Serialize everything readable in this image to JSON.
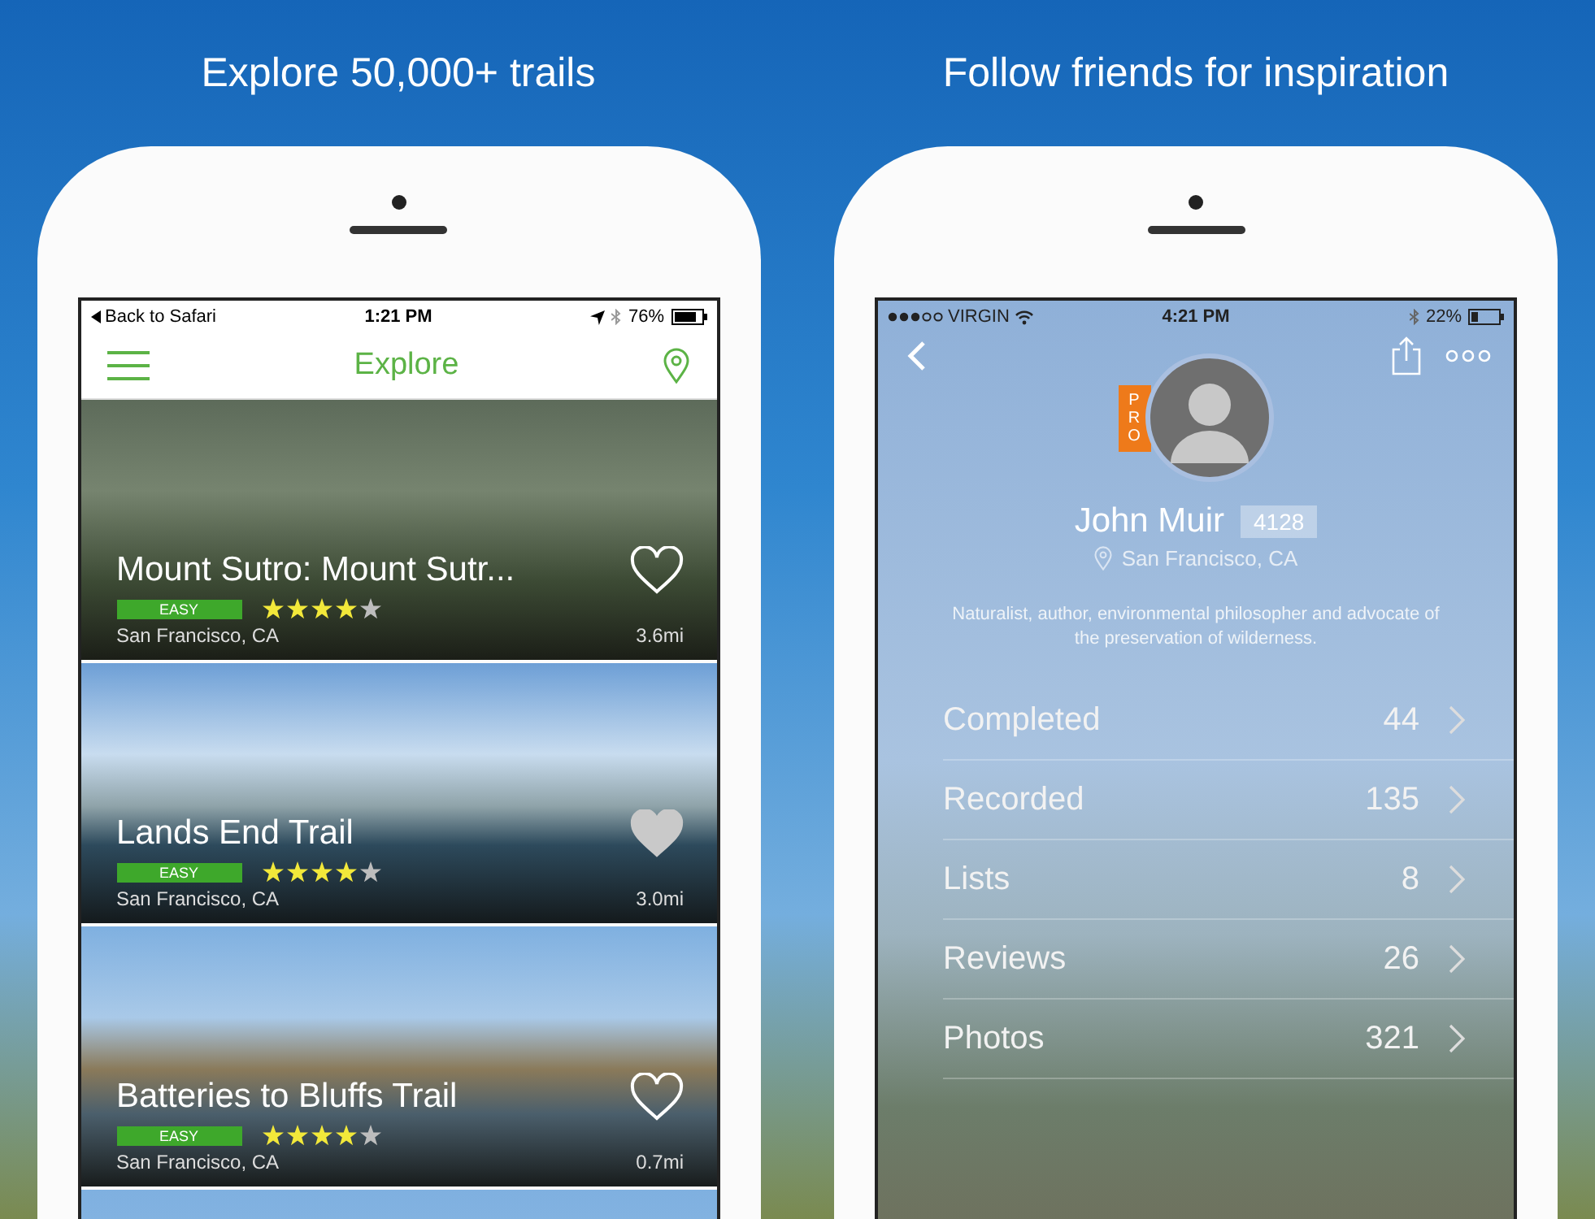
{
  "panels": [
    {
      "kind": "explore",
      "caption": "Explore 50,000+ trails",
      "status_bar": {
        "back": "Back to Safari",
        "time": "1:21 PM",
        "battery": "76%"
      },
      "nav": {
        "title": "Explore"
      },
      "trails": [
        {
          "name": "Mount Sutro: Mount Sutr...",
          "difficulty": "EASY",
          "stars": 4,
          "location": "San Francisco,  CA",
          "distance": "3.6mi",
          "favorited": false
        },
        {
          "name": "Lands End Trail",
          "difficulty": "EASY",
          "stars": 4,
          "location": "San Francisco,  CA",
          "distance": "3.0mi",
          "favorited": true
        },
        {
          "name": "Batteries to Bluffs Trail",
          "difficulty": "EASY",
          "stars": 4,
          "location": "San Francisco,  CA",
          "distance": "0.7mi",
          "favorited": false
        }
      ]
    },
    {
      "kind": "profile",
      "caption": "Follow friends for inspiration",
      "status_bar": {
        "carrier": "VIRGIN",
        "time": "4:21 PM",
        "battery": "22%"
      },
      "profile": {
        "pro_badge": "PRO",
        "name": "John Muir",
        "score": "4128",
        "location": "San Francisco, CA",
        "bio": "Naturalist, author, environmental philosopher and advocate of the preservation of wilderness."
      },
      "stats": [
        {
          "label": "Completed",
          "value": "44"
        },
        {
          "label": "Recorded",
          "value": "135"
        },
        {
          "label": "Lists",
          "value": "8"
        },
        {
          "label": "Reviews",
          "value": "26"
        },
        {
          "label": "Photos",
          "value": "321"
        }
      ]
    }
  ]
}
